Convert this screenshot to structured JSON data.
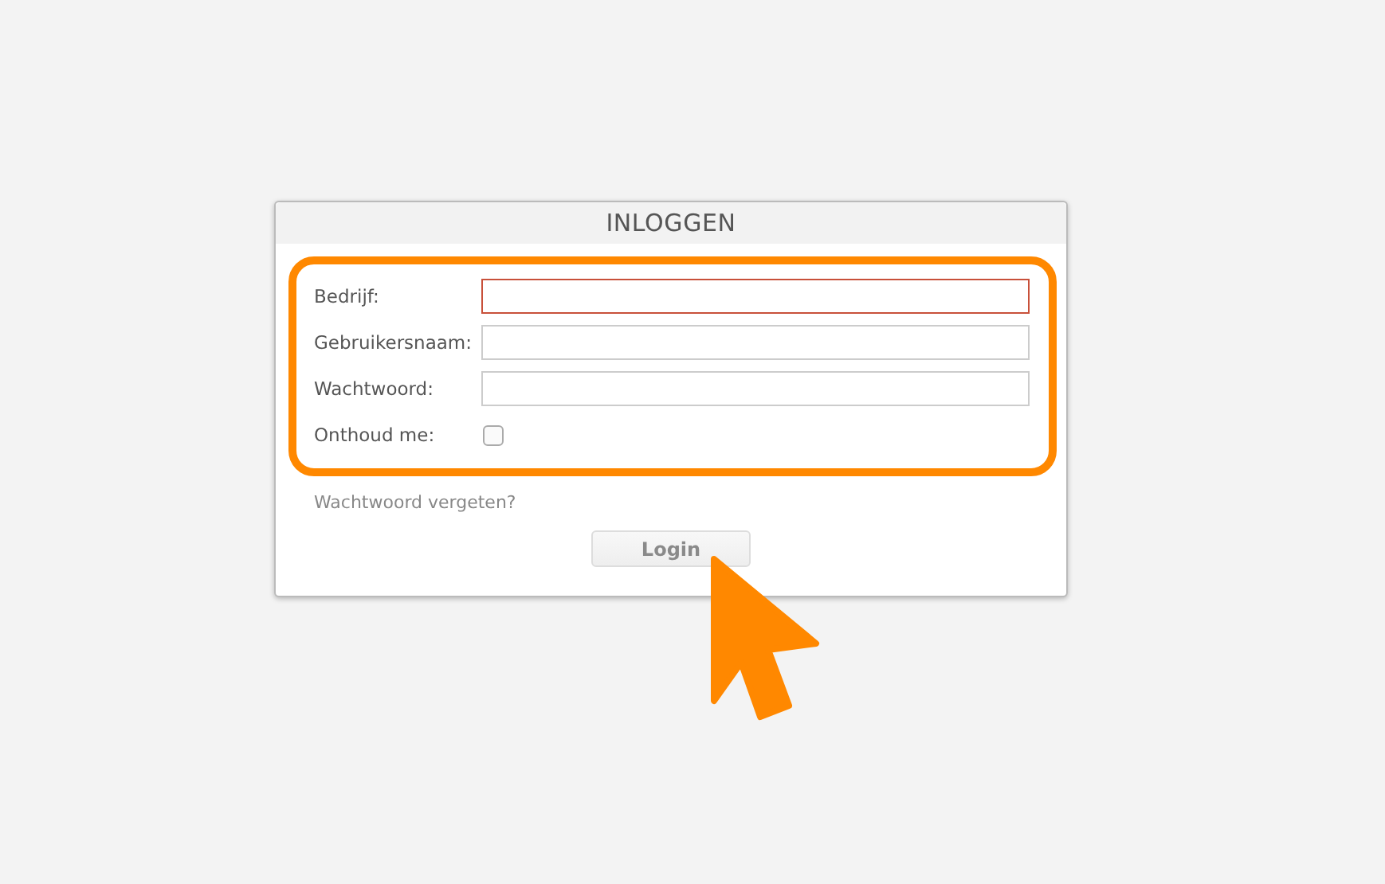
{
  "dialog": {
    "title": "INLOGGEN",
    "fields": [
      {
        "kind": "text",
        "label": "Bedrijf:",
        "invalid": true
      },
      {
        "kind": "text",
        "label": "Gebruikersnaam:",
        "invalid": false
      },
      {
        "kind": "password",
        "label": "Wachtwoord:",
        "invalid": false
      },
      {
        "kind": "checkbox",
        "label": "Onthoud me:",
        "checked": false
      }
    ],
    "link": "Wachtwoord vergeten?",
    "button": {
      "label": "Login",
      "disabled": true
    }
  }
}
